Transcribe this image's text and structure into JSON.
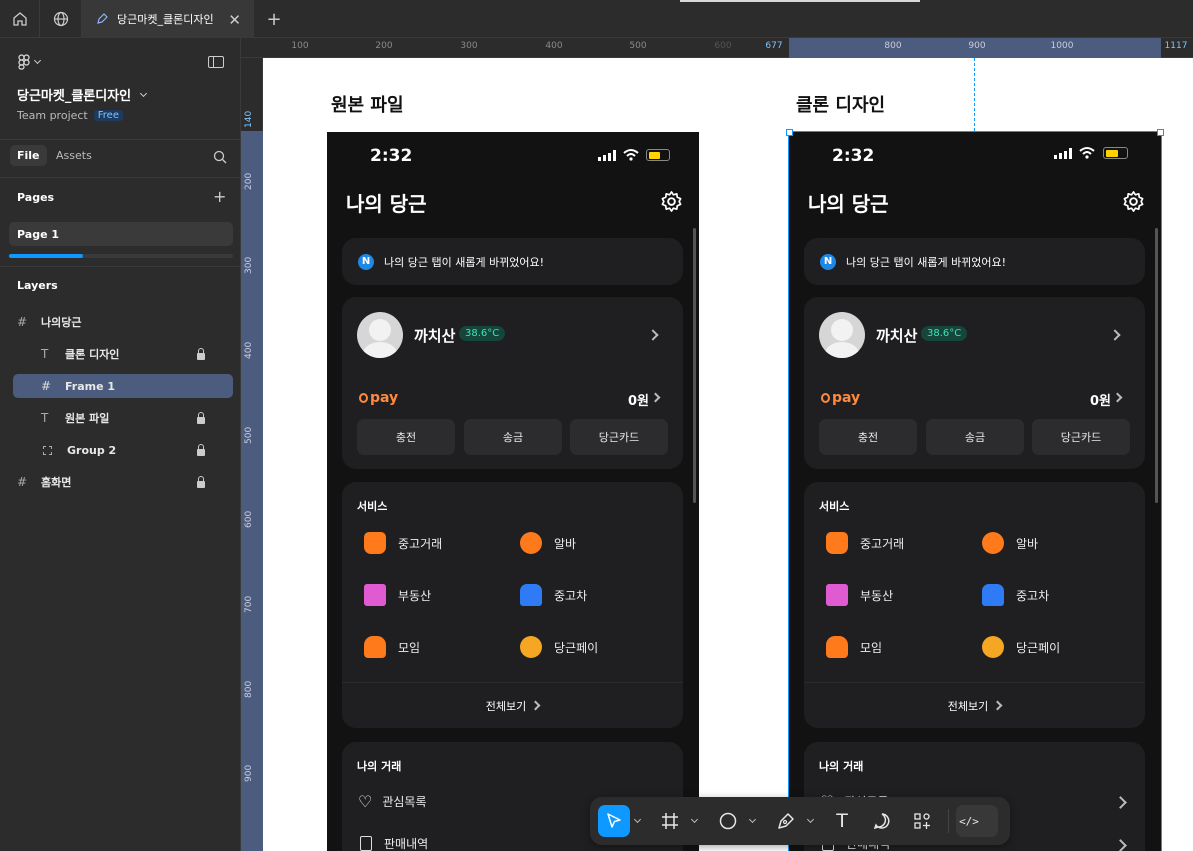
{
  "tabbar": {
    "tab_title": "당근마켓_클론디자인",
    "home_icon": "home-icon",
    "globe_icon": "globe-icon",
    "add_tab_label": "+"
  },
  "sidebar": {
    "file_title": "당근마켓_클론디자인",
    "team_label": "Team project",
    "plan_badge": "Free",
    "tabs": {
      "file": "File",
      "assets": "Assets"
    },
    "pages_header": "Pages",
    "page_item": "Page 1",
    "layers_header": "Layers",
    "layers": [
      {
        "label": "나의당근",
        "icon": "frame-icon",
        "locked": false
      },
      {
        "label": "클론 디자인",
        "icon": "text-icon",
        "locked": true
      },
      {
        "label": "Frame 1",
        "icon": "frame-icon",
        "locked": false,
        "selected": true
      },
      {
        "label": "원본 파일",
        "icon": "text-icon",
        "locked": true
      },
      {
        "label": "Group 2",
        "icon": "group-icon",
        "locked": true
      },
      {
        "label": "홈화면",
        "icon": "frame-icon",
        "locked": true
      }
    ]
  },
  "ruler": {
    "top_ticks": [
      "100",
      "200",
      "300",
      "400",
      "500",
      "600",
      "677",
      "800",
      "900",
      "1000",
      "1117"
    ],
    "left_ticks": [
      "140",
      "200",
      "300",
      "400",
      "500",
      "600",
      "700",
      "800",
      "900"
    ]
  },
  "canvas": {
    "label_original": "원본 파일",
    "label_clone": "클론 디자인"
  },
  "phone": {
    "time": "2:32",
    "title": "나의 당근",
    "notice": "나의 당근 탭이 새롭게 바뀌었어요!",
    "notice_badge": "N",
    "profile_name": "까치산",
    "temperature": "38.6°C",
    "pay_logo": "pay",
    "pay_amount": "0원",
    "pay_buttons": [
      "충전",
      "송금",
      "당근카드"
    ],
    "services_title": "서비스",
    "services": [
      {
        "label": "중고거래",
        "color": "#ff7a1a"
      },
      {
        "label": "알바",
        "color": "#ff7a1a"
      },
      {
        "label": "부동산",
        "color": "#e05bd2"
      },
      {
        "label": "중고차",
        "color": "#2f7bf5"
      },
      {
        "label": "모임",
        "color": "#ff7a1a"
      },
      {
        "label": "당근페이",
        "color": "#f5a623"
      }
    ],
    "see_all": "전체보기",
    "trade_title": "나의 거래",
    "trade_items": [
      "관심목록",
      "판매내역"
    ]
  },
  "toolbar": {
    "tools": [
      "move-tool",
      "frame-tool",
      "shape-tool",
      "pen-tool",
      "text-tool",
      "comment-tool",
      "actions-tool",
      "dev-mode-toggle"
    ]
  },
  "colors": {
    "accent": "#0d99ff",
    "selection": "#4c5c7e",
    "canvas": "#ffffff",
    "ui_bg": "#2c2c2c"
  }
}
